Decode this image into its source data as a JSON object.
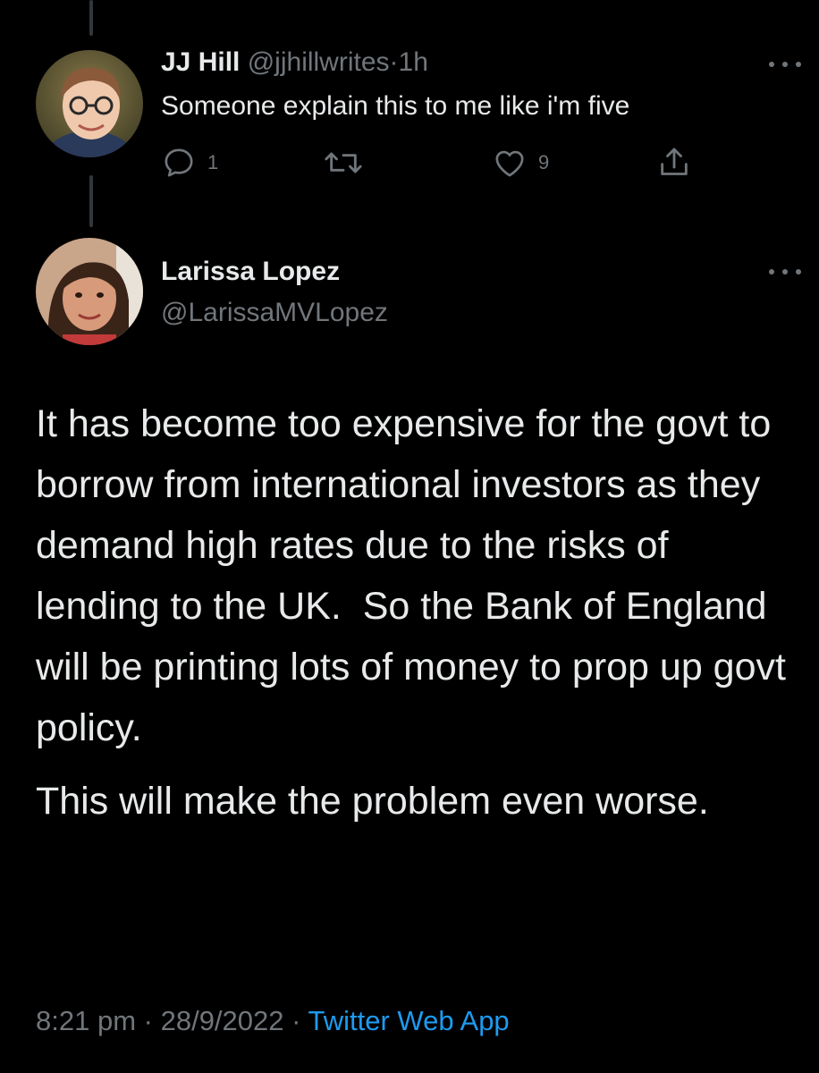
{
  "colors": {
    "background": "#000000",
    "text_primary": "#e7e9ea",
    "text_secondary": "#71767b",
    "link": "#1d9bf0",
    "thread_line": "#333639"
  },
  "reply": {
    "author_name": "JJ Hill",
    "author_handle": "@jjhillwrites",
    "separator": "·",
    "time": "1h",
    "text": "Someone explain this to me like i'm five",
    "actions": {
      "reply_icon": "speech-bubble-icon",
      "reply_count": "1",
      "retweet_icon": "retweet-icon",
      "like_icon": "heart-icon",
      "like_count": "9",
      "share_icon": "share-icon"
    }
  },
  "tweet": {
    "author_name": "Larissa Lopez",
    "author_handle": "@LarissaMVLopez",
    "paragraphs": [
      "It has become too expensive for the govt to borrow from international investors as they demand high rates due to the risks of lending to the UK.  So the Bank of England will be printing lots of money to prop up govt policy.",
      "This will make the problem even worse."
    ],
    "time": "8:21 pm",
    "separator": "·",
    "date": "28/9/2022",
    "source": "Twitter Web App"
  }
}
